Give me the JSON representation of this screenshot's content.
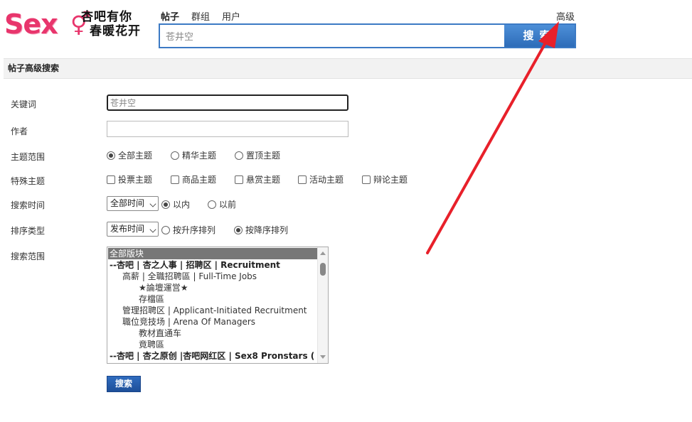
{
  "logo": {
    "text": "Sex",
    "symbol": "⚥",
    "slogan_line1": "杏吧有你",
    "slogan_line2": "春暖花开"
  },
  "search": {
    "tabs": [
      {
        "label": "帖子",
        "active": true
      },
      {
        "label": "群组",
        "active": false
      },
      {
        "label": "用户",
        "active": false
      }
    ],
    "advanced_label": "高级",
    "query": "苍井空",
    "button_label": "搜索"
  },
  "section": {
    "title": "帖子高级搜索"
  },
  "form": {
    "keyword": {
      "label": "关键词",
      "value": "苍井空"
    },
    "author": {
      "label": "作者",
      "value": ""
    },
    "scope": {
      "label": "主题范围",
      "options": [
        "全部主题",
        "精华主题",
        "置顶主题"
      ],
      "selected": "全部主题"
    },
    "special": {
      "label": "特殊主题",
      "options": [
        "投票主题",
        "商品主题",
        "悬赏主题",
        "活动主题",
        "辩论主题"
      ]
    },
    "time": {
      "label": "搜索时间",
      "select_value": "全部时间",
      "options": [
        "以内",
        "以前"
      ],
      "selected": "以内"
    },
    "order": {
      "label": "排序类型",
      "select_value": "发布时间",
      "options": [
        "按升序排列",
        "按降序排列"
      ],
      "selected": "按降序排列"
    },
    "forums": {
      "label": "搜索范围",
      "items": [
        {
          "text": "全部版块",
          "level": 0,
          "selected": true,
          "bold": false
        },
        {
          "text": "--杏吧 | 杏之人事 | 招聘区 | Recruitment",
          "level": 0,
          "selected": false,
          "bold": true
        },
        {
          "text": "高薪 | 全職招聘區 | Full-Time Jobs",
          "level": 1,
          "selected": false,
          "bold": false
        },
        {
          "text": "★論壇運営★",
          "level": 2,
          "selected": false,
          "bold": false
        },
        {
          "text": "存檔區",
          "level": 2,
          "selected": false,
          "bold": false
        },
        {
          "text": "管理招聘区 | Applicant-Initiated Recruitment",
          "level": 1,
          "selected": false,
          "bold": false
        },
        {
          "text": "職位竞技场 | Arena Of Managers",
          "level": 1,
          "selected": false,
          "bold": false
        },
        {
          "text": "教材直通车",
          "level": 2,
          "selected": false,
          "bold": false
        },
        {
          "text": "竟聘區",
          "level": 2,
          "selected": false,
          "bold": false
        },
        {
          "text": "--杏吧 | 杏之原创 |杏吧网红区 | Sex8 Pronstars (",
          "level": 0,
          "selected": false,
          "bold": true
        }
      ]
    },
    "submit_label": "搜索"
  },
  "annotation": {
    "arrow_color": "#e8202a"
  }
}
